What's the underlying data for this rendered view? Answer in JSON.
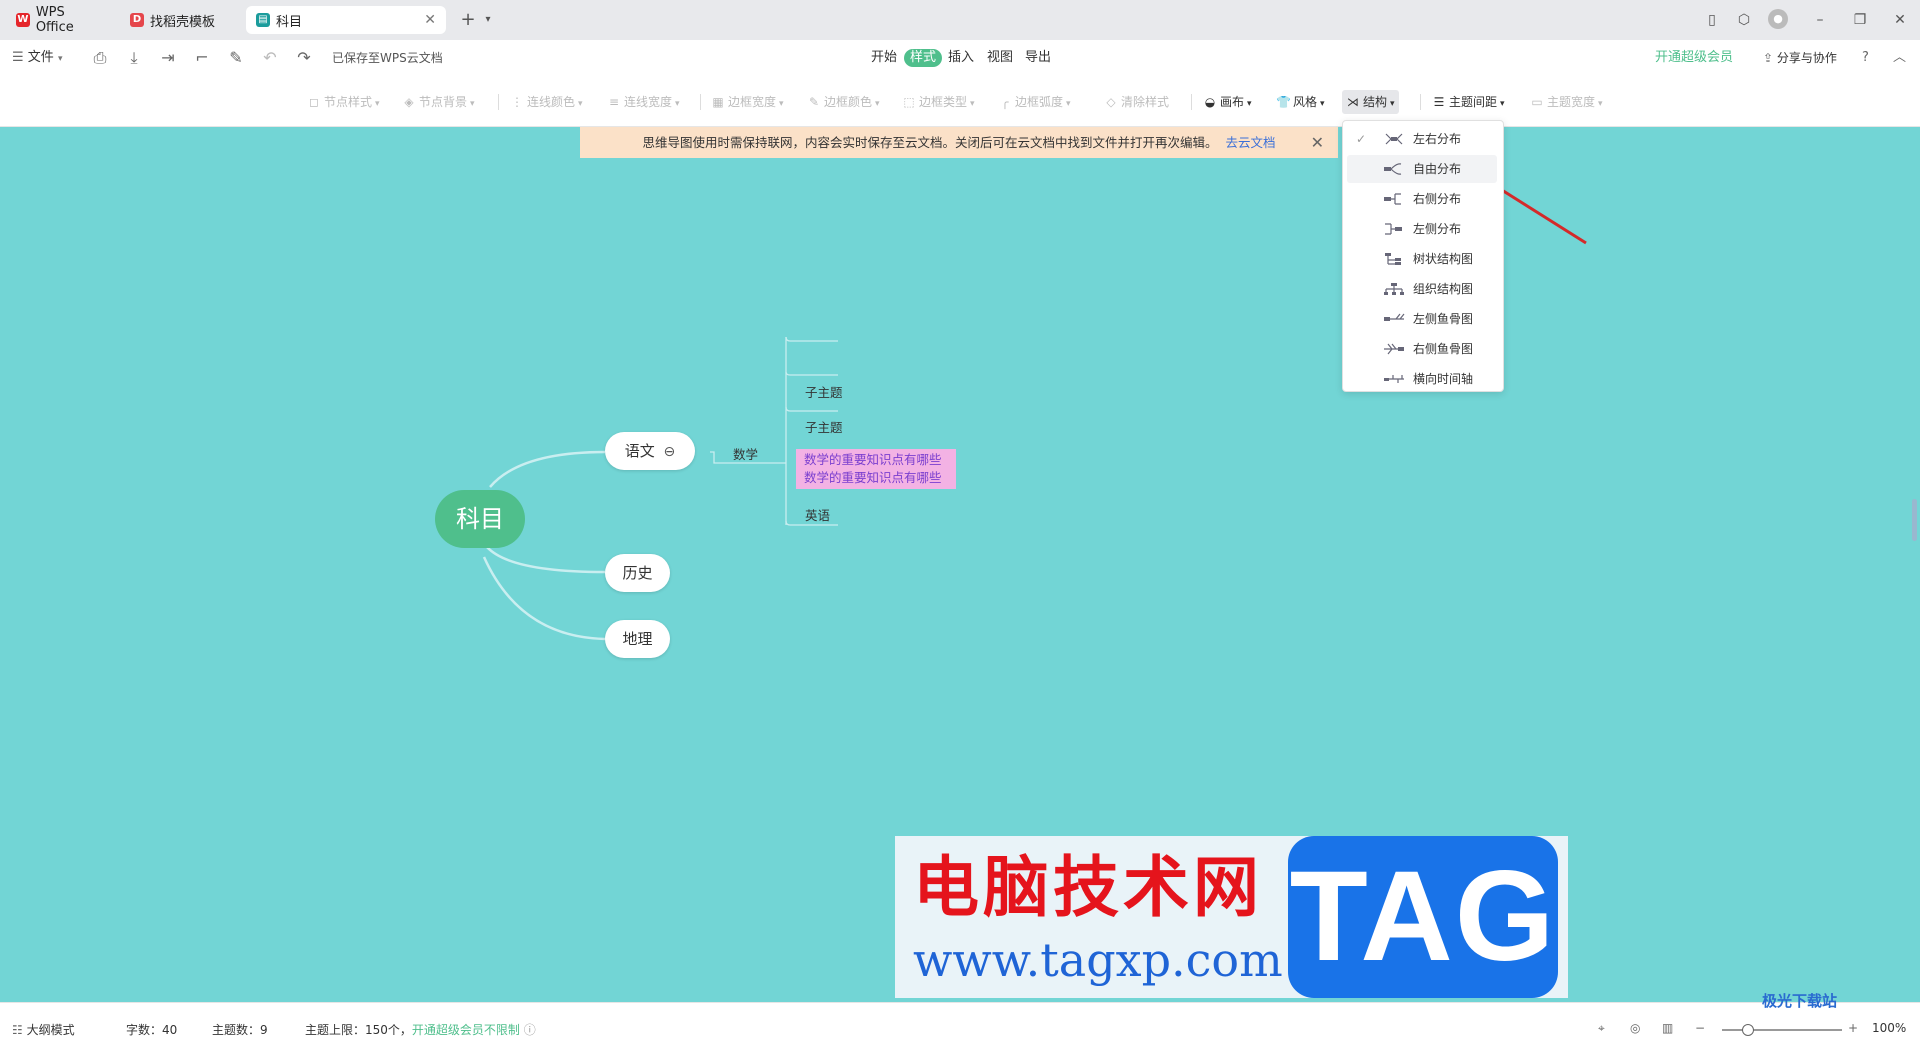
{
  "tabs": [
    {
      "label": "WPS Office"
    },
    {
      "label": "找稻壳模板"
    },
    {
      "label": "科目"
    }
  ],
  "menu": {
    "file": "文件",
    "saved_status": "已保存至WPS云文档",
    "items": [
      "开始",
      "样式",
      "插入",
      "视图",
      "导出"
    ],
    "active_item": "样式",
    "vip": "开通超级会员",
    "share": "分享与协作",
    "help": "?"
  },
  "toolbar": {
    "items": [
      "节点样式",
      "节点背景",
      "连线颜色",
      "连线宽度",
      "边框宽度",
      "边框颜色",
      "边框类型",
      "边框弧度",
      "清除样式",
      "画布",
      "风格",
      "结构",
      "主题间距",
      "主题宽度"
    ]
  },
  "notice": {
    "text": "思维导图使用时需保持联网，内容会实时保存至云文档。关闭后可在云文档中找到文件并打开再次编辑。",
    "link": "去云文档"
  },
  "structure_menu": {
    "items": [
      "左右分布",
      "自由分布",
      "右侧分布",
      "左侧分布",
      "树状结构图",
      "组织结构图",
      "左侧鱼骨图",
      "右侧鱼骨图",
      "横向时间轴"
    ],
    "checked": "左右分布",
    "highlighted": "自由分布"
  },
  "mindmap": {
    "root": "科目",
    "branch1": "语文",
    "branch1_child": "数学",
    "subtopic1": "子主题",
    "subtopic2": "子主题",
    "note_line1": "数学的重要知识点有哪些",
    "note_line2": "数学的重要知识点有哪些",
    "english": "英语",
    "branch2": "历史",
    "branch3": "地理"
  },
  "status": {
    "outline": "大纲模式",
    "word_count": "字数：40",
    "topic_count": "主题数：9",
    "topic_limit": "主题上限：150个，",
    "vip_unlimited": "开通超级会员不限制",
    "zoom": "100%"
  },
  "watermark": {
    "site_cn": "电脑技术网",
    "site_url": "www.tagxp.com",
    "tag": "TAG",
    "corner": "极光下载站"
  },
  "colors": {
    "canvas": "#72d5d5",
    "root_node": "#4fbf8c",
    "accent_green": "#4fbf8c",
    "notice_bg": "#fbe1c8",
    "note_bg": "#f3b2e4",
    "note_text": "#7b3fcf",
    "arrow": "#d42a2a"
  }
}
